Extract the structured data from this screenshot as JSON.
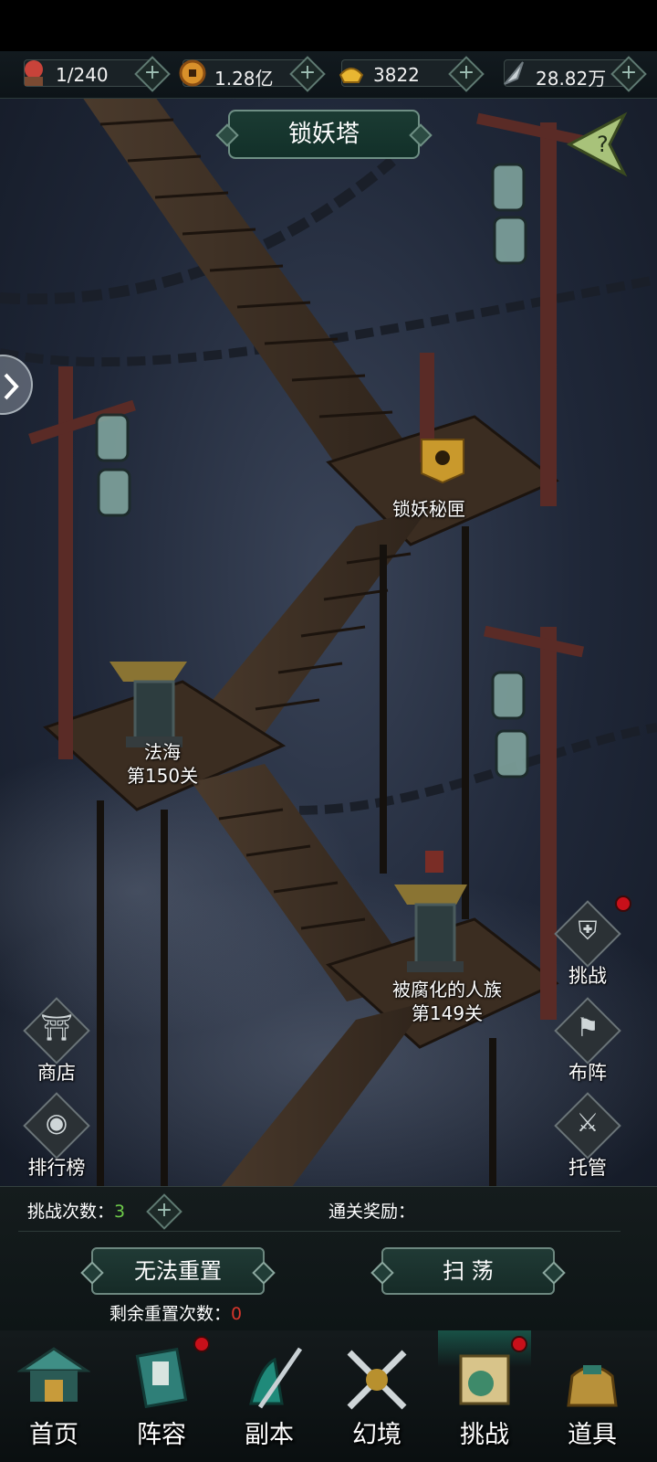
{
  "resources": [
    {
      "icon": "stamina-orb-icon",
      "value": "1/240",
      "color": "#c8433a"
    },
    {
      "icon": "copper-coin-icon",
      "value": "1.28亿",
      "color": "#d8902a"
    },
    {
      "icon": "gold-ingot-icon",
      "value": "3822",
      "color": "#e8b632"
    },
    {
      "icon": "silver-feather-icon",
      "value": "28.82万",
      "color": "#c8d0d4"
    }
  ],
  "title": "锁妖塔",
  "stages": {
    "chest_label": "锁妖秘匣",
    "stage_top": {
      "name": "法海",
      "level": "第150关"
    },
    "stage_bottom": {
      "name": "被腐化的人族",
      "level": "第149关"
    }
  },
  "left_buttons": {
    "shop": "商店",
    "ranking": "排行榜"
  },
  "right_buttons": {
    "challenge": "挑战",
    "formation": "布阵",
    "auto": "托管"
  },
  "panel": {
    "attempts_label": "挑战次数：",
    "attempts_value": "3",
    "attempts_color": "#6ecb4a",
    "reward_label": "通关奖励：",
    "reset_button": "无法重置",
    "sweep_button": "扫 荡",
    "reset_remaining_label": "剩余重置次数：",
    "reset_remaining_value": "0",
    "reset_remaining_color": "#d8362c"
  },
  "nav": [
    {
      "label": "首页",
      "icon": "pavilion-icon",
      "badge": false
    },
    {
      "label": "阵容",
      "icon": "book-scroll-icon",
      "badge": true
    },
    {
      "label": "副本",
      "icon": "sword-warrior-icon",
      "badge": false
    },
    {
      "label": "幻境",
      "icon": "crossed-swords-icon",
      "badge": false
    },
    {
      "label": "挑战",
      "icon": "challenge-scroll-icon",
      "badge": true
    },
    {
      "label": "道具",
      "icon": "item-bag-icon",
      "badge": false
    }
  ],
  "colors": {
    "accent_frame": "#6e8f84",
    "badge_red": "#c8101a"
  }
}
